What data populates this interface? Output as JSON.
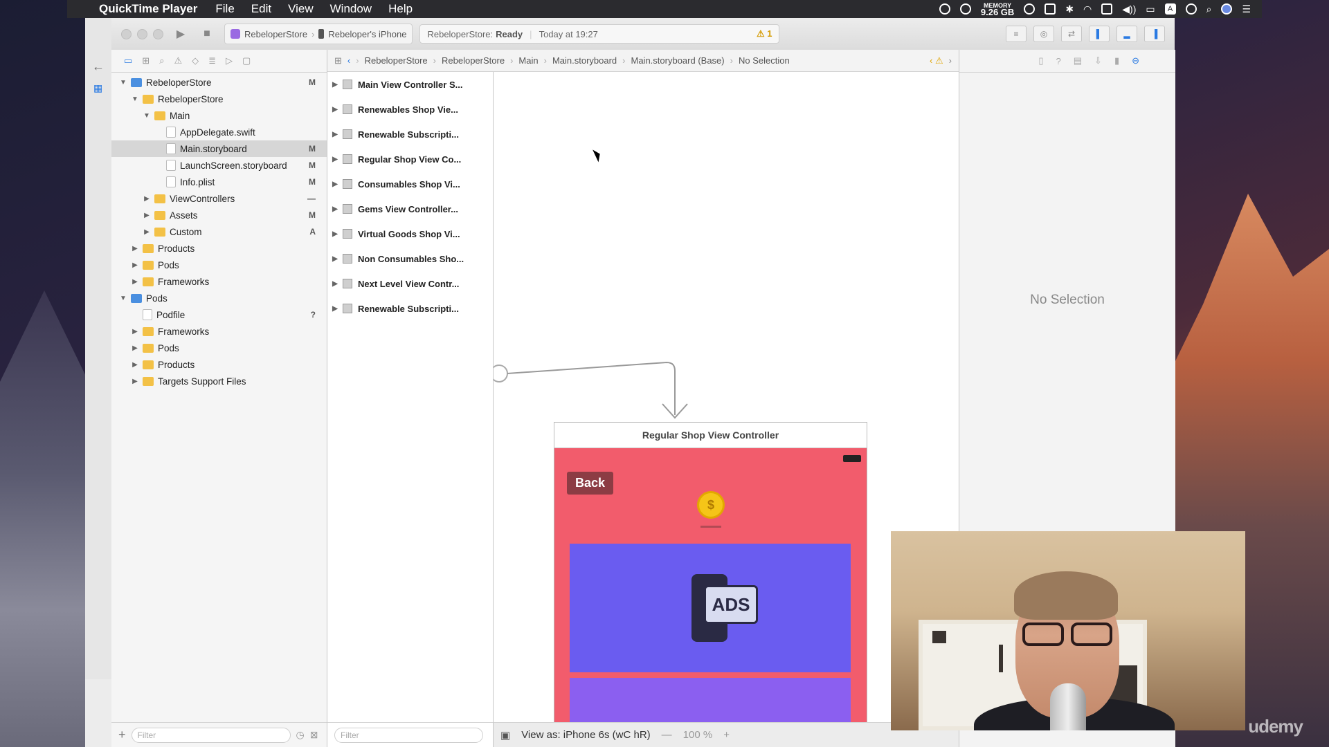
{
  "menubar": {
    "app_name": "QuickTime Player",
    "items": [
      "File",
      "Edit",
      "View",
      "Window",
      "Help"
    ],
    "memory_label": "MEMORY",
    "memory_value": "9.26 GB",
    "letter_icon": "A"
  },
  "toolbar": {
    "scheme": "RebeloperStore",
    "device": "Rebeloper's iPhone",
    "status_app": "RebeloperStore:",
    "status_state": "Ready",
    "status_time": "Today at 19:27",
    "warning_count": "1"
  },
  "navigator": {
    "tree": [
      {
        "label": "RebeloperStore",
        "indent": 0,
        "icon": "project-icon",
        "expanded": true,
        "status": "M"
      },
      {
        "label": "RebeloperStore",
        "indent": 1,
        "icon": "folder-icon",
        "expanded": true,
        "status": ""
      },
      {
        "label": "Main",
        "indent": 2,
        "icon": "folder-icon",
        "expanded": true,
        "status": ""
      },
      {
        "label": "AppDelegate.swift",
        "indent": 3,
        "icon": "file-icon",
        "status": ""
      },
      {
        "label": "Main.storyboard",
        "indent": 3,
        "icon": "file-icon",
        "status": "M",
        "selected": true
      },
      {
        "label": "LaunchScreen.storyboard",
        "indent": 3,
        "icon": "file-icon",
        "status": "M"
      },
      {
        "label": "Info.plist",
        "indent": 3,
        "icon": "file-icon",
        "status": "M"
      },
      {
        "label": "ViewControllers",
        "indent": 2,
        "icon": "folder-icon",
        "expanded": false,
        "status": "—"
      },
      {
        "label": "Assets",
        "indent": 2,
        "icon": "folder-icon",
        "expanded": false,
        "status": "M"
      },
      {
        "label": "Custom",
        "indent": 2,
        "icon": "folder-icon",
        "expanded": false,
        "status": "A"
      },
      {
        "label": "Products",
        "indent": 1,
        "icon": "folder-icon",
        "expanded": false,
        "status": ""
      },
      {
        "label": "Pods",
        "indent": 1,
        "icon": "folder-icon",
        "expanded": false,
        "status": ""
      },
      {
        "label": "Frameworks",
        "indent": 1,
        "icon": "folder-icon",
        "expanded": false,
        "status": ""
      },
      {
        "label": "Pods",
        "indent": 0,
        "icon": "project-icon",
        "expanded": true,
        "status": ""
      },
      {
        "label": "Podfile",
        "indent": 1,
        "icon": "file-icon",
        "status": "?"
      },
      {
        "label": "Frameworks",
        "indent": 1,
        "icon": "folder-icon",
        "expanded": false,
        "status": ""
      },
      {
        "label": "Pods",
        "indent": 1,
        "icon": "folder-icon",
        "expanded": false,
        "status": ""
      },
      {
        "label": "Products",
        "indent": 1,
        "icon": "folder-icon",
        "expanded": false,
        "status": ""
      },
      {
        "label": "Targets Support Files",
        "indent": 1,
        "icon": "folder-icon",
        "expanded": false,
        "status": ""
      }
    ],
    "filter_placeholder": "Filter"
  },
  "jumpbar": {
    "crumbs": [
      "RebeloperStore",
      "RebeloperStore",
      "Main",
      "Main.storyboard",
      "Main.storyboard (Base)",
      "No Selection"
    ]
  },
  "outline": {
    "items": [
      "Main View Controller S...",
      "Renewables Shop Vie...",
      "Renewable Subscripti...",
      "Regular Shop View Co...",
      "Consumables Shop Vi...",
      "Gems View Controller...",
      "Virtual Goods Shop Vi...",
      "Non Consumables Sho...",
      "Next Level View Contr...",
      "Renewable Subscripti..."
    ],
    "filter_placeholder": "Filter"
  },
  "canvas": {
    "scene_title": "Regular Shop View Controller",
    "back_label": "Back",
    "ads_label": "ADS",
    "coin_symbol": "$",
    "view_as": "View as: iPhone 6s (wC hR)",
    "zoom": "100 %",
    "zoom_out": "—",
    "zoom_in": "+"
  },
  "inspector": {
    "empty_label": "No Selection"
  },
  "watermark": "udemy",
  "colors": {
    "accent": "#2a7ae2",
    "phone_bg": "#f25c6c",
    "ads_bg": "#6a5cf0",
    "folder": "#f3c146"
  }
}
